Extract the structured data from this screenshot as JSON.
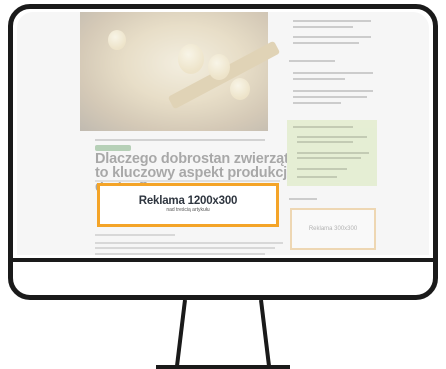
{
  "article": {
    "title": "Dlaczego dobrostan zwierząt to kluczowy aspekt produkcji drobiu?"
  },
  "ads": {
    "main_size": "Reklama 1200x300",
    "main_caption": "nad treścią artykułu",
    "sidebar_size": "Reklama 300x300"
  },
  "colors": {
    "ad_border": "#f4a428",
    "category_tag": "#3f9a45",
    "sidebar_box": "#c8e68c",
    "frame": "#1a1a1a"
  }
}
